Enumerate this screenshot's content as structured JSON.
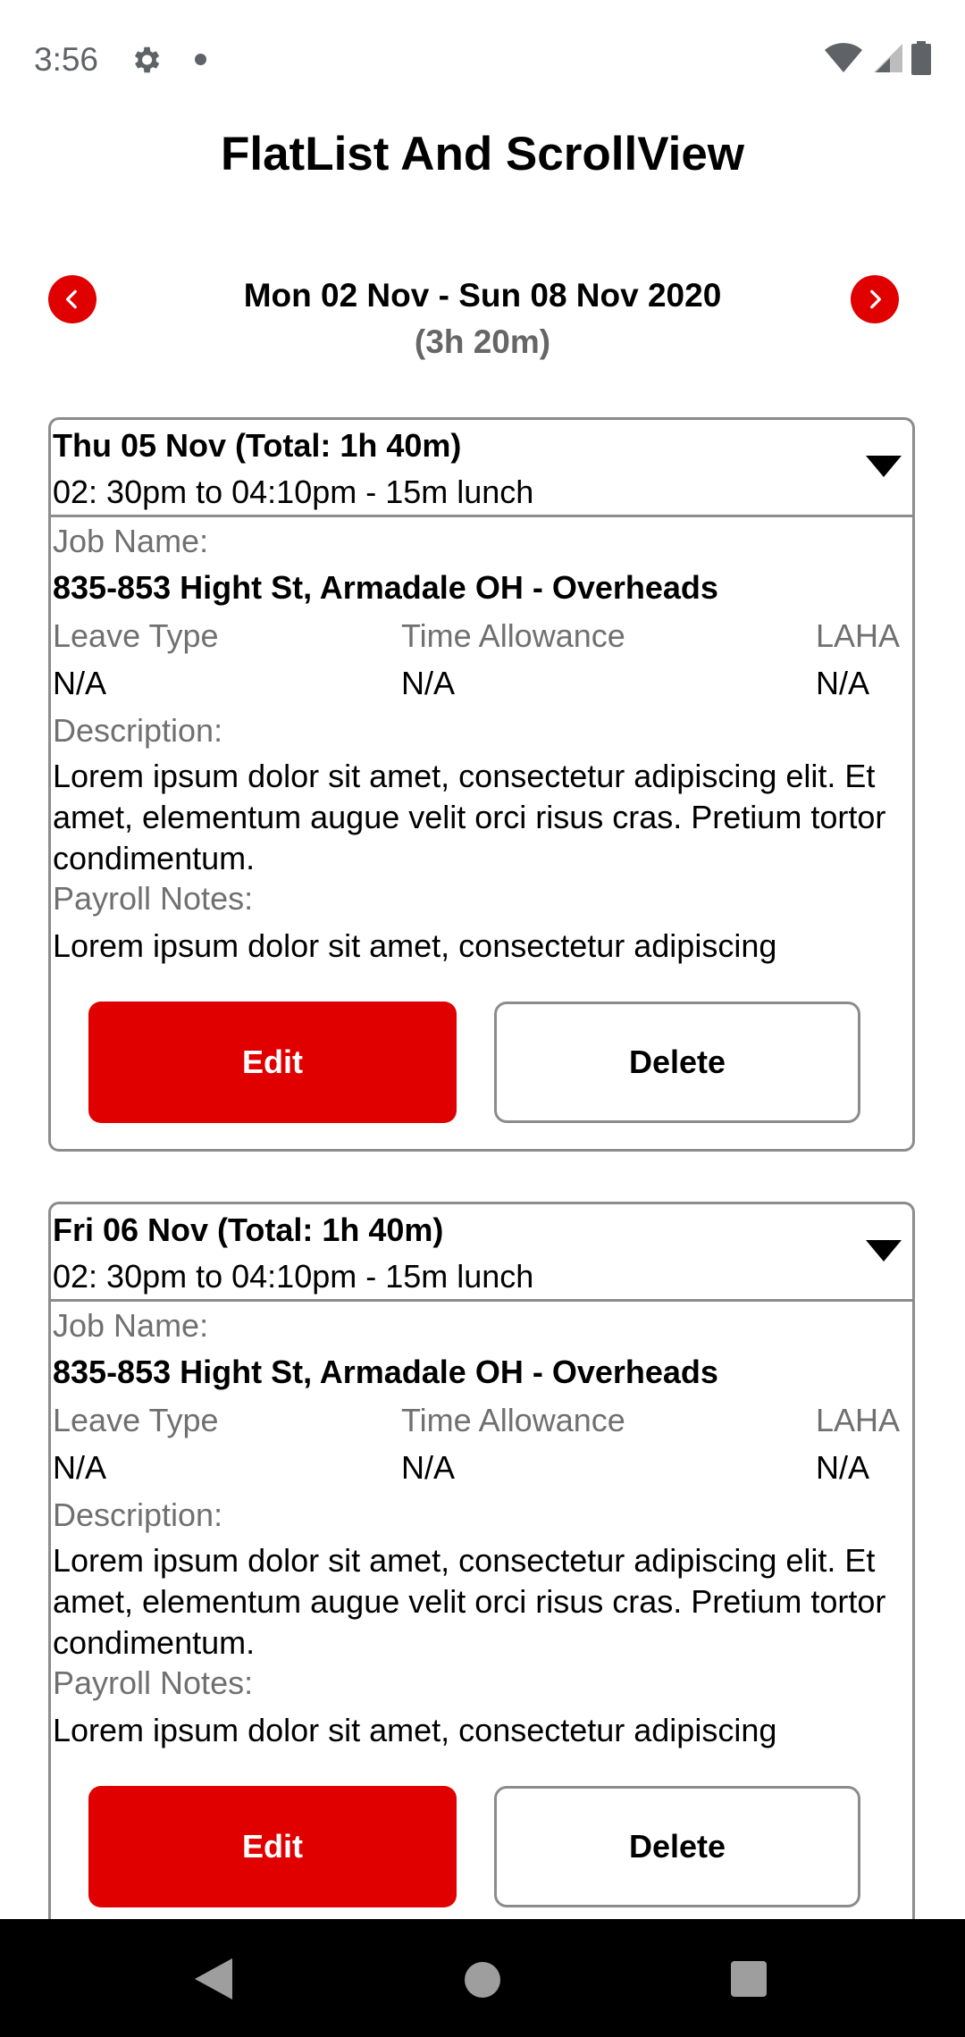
{
  "status": {
    "time": "3:56"
  },
  "app": {
    "title": "FlatList And ScrollView"
  },
  "week": {
    "range": "Mon 02 Nov - Sun 08 Nov 2020",
    "total": "(3h 20m)"
  },
  "labels": {
    "job_name": "Job Name:",
    "leave_type": "Leave Type",
    "time_allowance": "Time Allowance",
    "laha": "LAHA",
    "description": "Description:",
    "payroll_notes": "Payroll Notes:",
    "edit": "Edit",
    "delete": "Delete"
  },
  "entries": [
    {
      "date_total": "Thu 05 Nov (Total: 1h 40m)",
      "time_range": "02: 30pm to 04:10pm - 15m lunch",
      "job_name": "835-853 Hight St, Armadale OH - Overheads",
      "leave_type": "N/A",
      "time_allowance": "N/A",
      "laha": "N/A",
      "description": "Lorem ipsum dolor sit amet, consectetur adipiscing elit. Et amet, elementum augue velit orci risus cras. Pretium tortor condimentum.",
      "payroll_notes": "Lorem ipsum dolor sit amet, consectetur adipiscing"
    },
    {
      "date_total": "Fri 06 Nov (Total: 1h 40m)",
      "time_range": "02: 30pm to 04:10pm - 15m lunch",
      "job_name": "835-853 Hight St, Armadale OH - Overheads",
      "leave_type": "N/A",
      "time_allowance": "N/A",
      "laha": "N/A",
      "description": "Lorem ipsum dolor sit amet, consectetur adipiscing elit. Et amet, elementum augue velit orci risus cras. Pretium tortor condimentum.",
      "payroll_notes": "Lorem ipsum dolor sit amet, consectetur adipiscing"
    }
  ],
  "colors": {
    "accent": "#e00000",
    "border": "#8c8c8c",
    "label": "#707070"
  }
}
